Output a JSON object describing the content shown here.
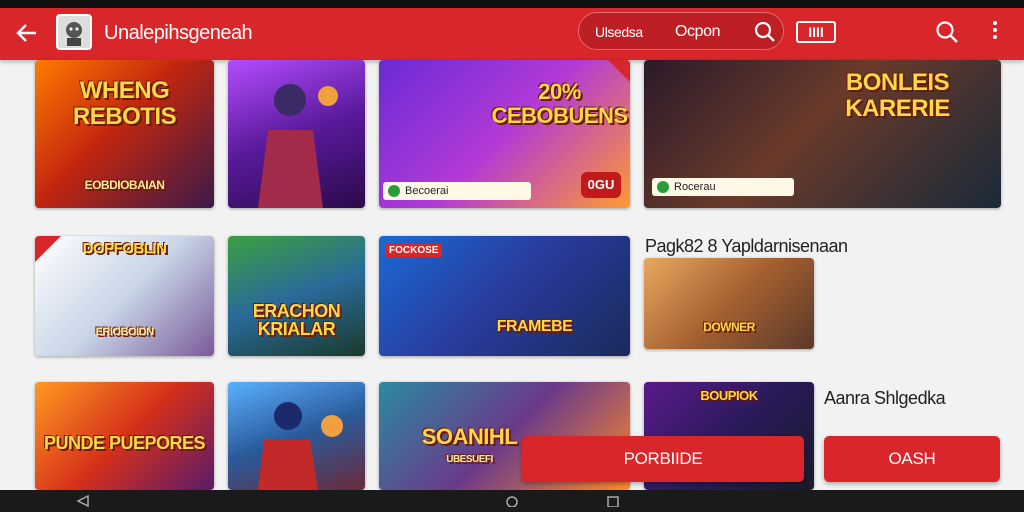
{
  "appbar": {
    "title": "Unalepihsgeneah",
    "pill_label_1": "Ulsedsa",
    "pill_label_2": "Ocpon",
    "badge": "IIII",
    "icons": [
      "back-arrow-icon",
      "app-logo",
      "search-icon",
      "badge-icon",
      "search-icon",
      "more-vert-icon"
    ]
  },
  "cards": [
    {
      "title": "WHENG REBOTIS",
      "caption": "EOBDIOBAIAN"
    },
    {
      "title": ""
    },
    {
      "title": "20% CEBOBUENS",
      "chip": "Becoerai",
      "price": "0GU"
    },
    {
      "title": "BONLEIS KARERIE",
      "chip": "Rocerau"
    },
    {
      "title": "DOPFOBLIN",
      "caption": "ERIOBOIDN"
    },
    {
      "title": "ERACHON KRIALAR"
    },
    {
      "title": "FRAMEBE",
      "tag": "FOCKOSE"
    },
    {
      "title": "DOWNER"
    },
    {
      "title": "PUNDE PUEPORES"
    },
    {
      "title": ""
    },
    {
      "title": "SOANIHL",
      "caption": "UBESUEFI"
    },
    {
      "title": "BOUPIOK"
    }
  ],
  "sections": {
    "label_1": "Pagk82 8 Yapldarnisenaan",
    "label_2": "Aanra Shlgedka"
  },
  "buttons": {
    "primary": "PORBIIDE",
    "secondary": "OASH"
  },
  "colors": {
    "brand": "#d8262a",
    "appbar_dark": "#bd1f24",
    "background": "#f2f2f2"
  }
}
